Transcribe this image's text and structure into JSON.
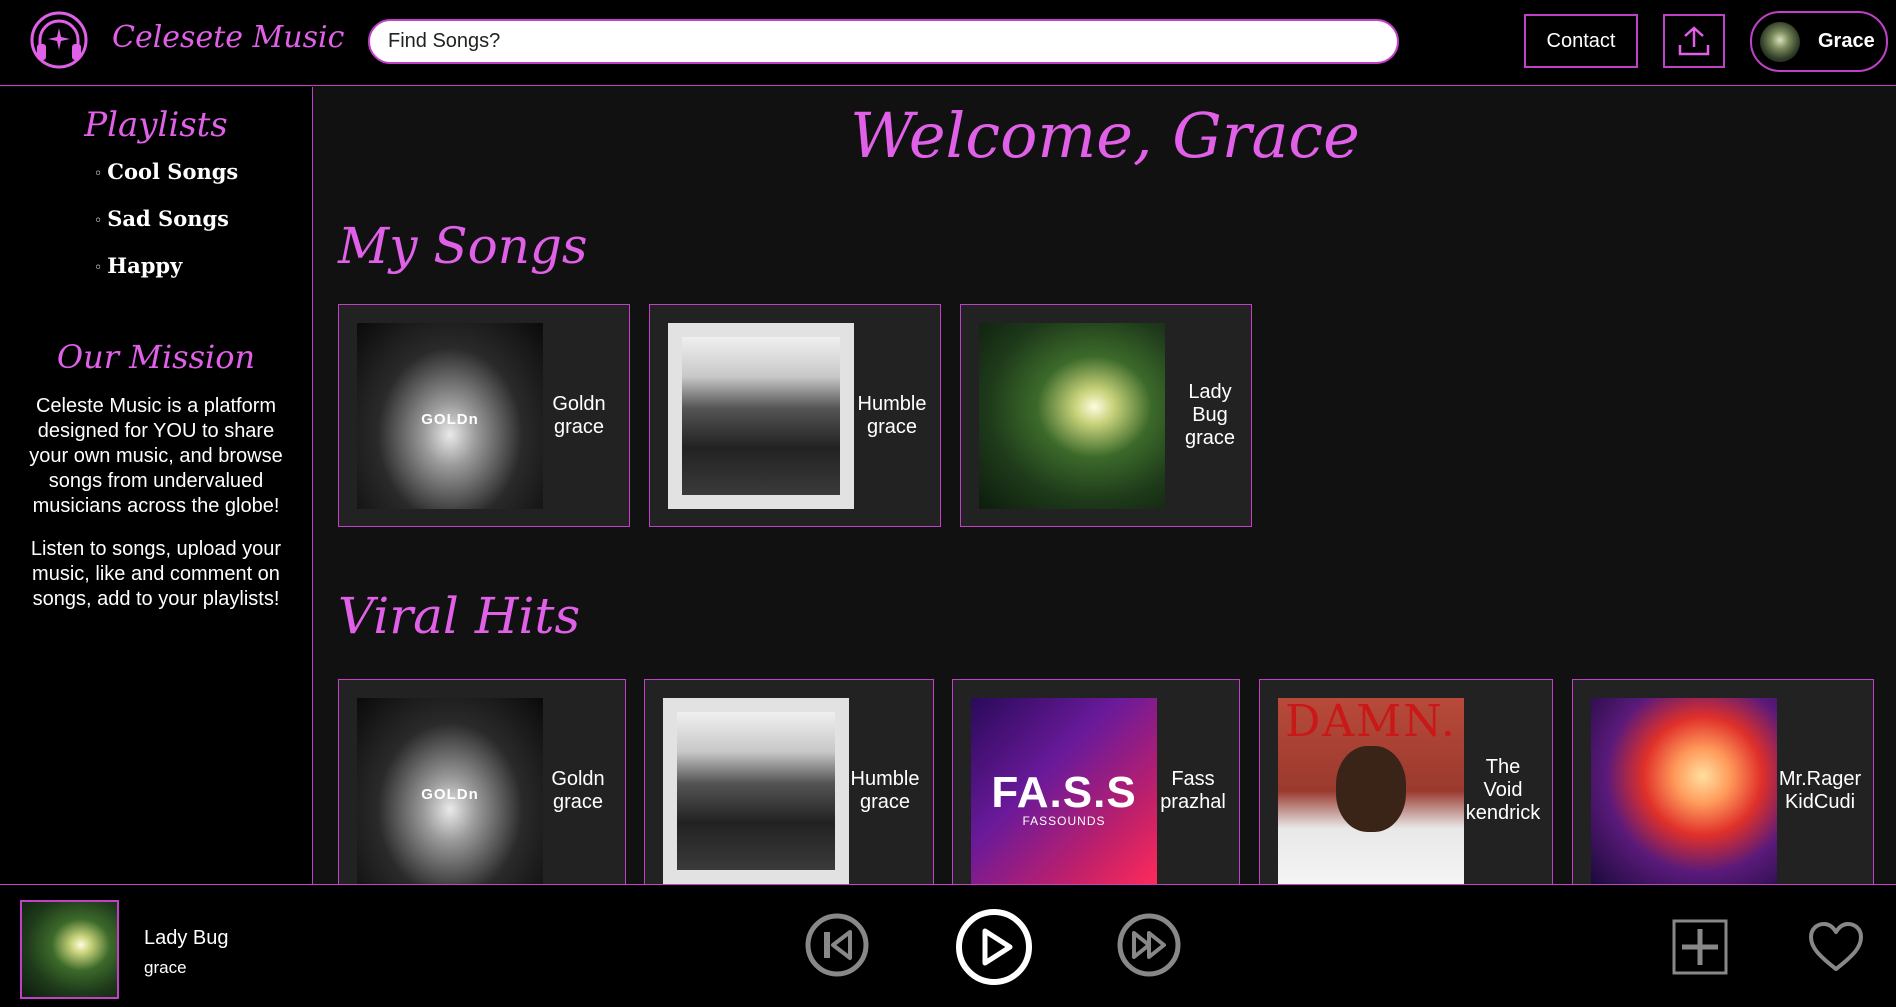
{
  "brand": {
    "name": "Celesete Music",
    "icon": "headphones-icon"
  },
  "search": {
    "placeholder": "Find Songs?"
  },
  "header": {
    "contact_label": "Contact",
    "upload_icon": "upload-icon",
    "user_name": "Grace"
  },
  "sidebar": {
    "playlists_heading": "Playlists",
    "playlists": [
      {
        "label": "Cool Songs"
      },
      {
        "label": "Sad Songs"
      },
      {
        "label": "Happy"
      }
    ],
    "mission_heading": "Our Mission",
    "mission_text_1": "Celeste Music is a platform designed for YOU to share your own music, and browse songs from undervalued musicians across the globe!",
    "mission_text_2": "Listen to songs, upload your music, like and comment on songs, add to your playlists!"
  },
  "main": {
    "welcome": "Welcome, Grace",
    "my_songs_title": "My Songs",
    "my_songs": [
      {
        "title": "Goldn",
        "artist": "grace",
        "cover_text": "GOLDn"
      },
      {
        "title": "Humble",
        "artist": "grace"
      },
      {
        "title": "Lady Bug",
        "artist": "grace"
      }
    ],
    "viral_title": "Viral Hits",
    "viral": [
      {
        "title": "Goldn",
        "artist": "grace",
        "cover_text": "GOLDn"
      },
      {
        "title": "Humble",
        "artist": "grace"
      },
      {
        "title": "Fass",
        "artist": "prazhal",
        "cover_text": "FA.S.S",
        "cover_sub": "FASSOUNDS"
      },
      {
        "title": "The Void",
        "artist": "kendrick",
        "cover_text": "DAMN."
      },
      {
        "title": "Mr.Rager",
        "artist": "KidCudi"
      }
    ]
  },
  "player": {
    "title": "Lady Bug",
    "artist": "grace",
    "controls": [
      "previous-icon",
      "play-icon",
      "next-icon",
      "add-icon",
      "heart-icon"
    ]
  },
  "colors": {
    "accent": "#e060e8",
    "border": "#c040c8",
    "background": "#111111",
    "card": "#222222"
  }
}
